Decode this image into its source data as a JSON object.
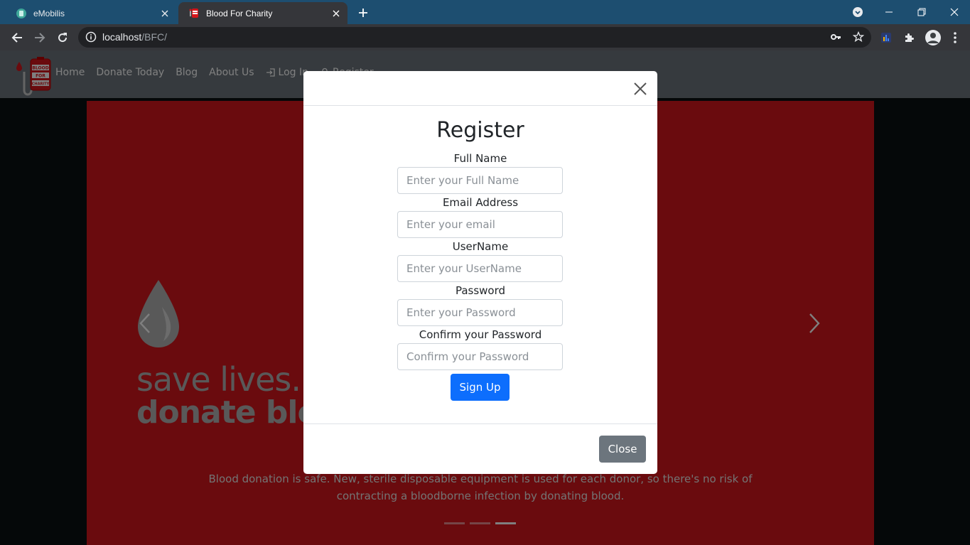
{
  "browser": {
    "tabs": [
      {
        "title": "eMobilis",
        "active": false
      },
      {
        "title": "Blood For Charity",
        "active": true
      }
    ],
    "url_host": "localhost",
    "url_path": "/BFC/"
  },
  "logo": {
    "line1": "BLOOD",
    "line2": "FOR",
    "line3": "CHARITY"
  },
  "nav": {
    "home": "Home",
    "donate": "Donate Today",
    "blog": "Blog",
    "about": "About Us",
    "login": "Log In",
    "register": "Register"
  },
  "hero": {
    "tagline_1": "save lives.",
    "tagline_2": "donate blood",
    "caption": "Blood donation is safe. New, sterile disposable equipment is used for each donor, so there's no risk of contracting a bloodborne infection by donating blood.",
    "slides_total": 3,
    "active_slide": 3
  },
  "modal": {
    "title": "Register",
    "fields": [
      {
        "label": "Full Name",
        "placeholder": "Enter your Full Name"
      },
      {
        "label": "Email Address",
        "placeholder": "Enter your email"
      },
      {
        "label": "UserName",
        "placeholder": "Enter your UserName"
      },
      {
        "label": "Password",
        "placeholder": "Enter your Password"
      },
      {
        "label": "Confirm your Password",
        "placeholder": "Confirm your Password"
      }
    ],
    "submit_label": "Sign Up",
    "close_label": "Close"
  },
  "colors": {
    "brand_red": "#d4161c",
    "navbar": "#6c757d",
    "primary": "#0d6efd",
    "secondary": "#6c757d"
  },
  "icons": [
    "favicon-emobilis-icon",
    "favicon-bfc-icon",
    "close-tab-icon",
    "new-tab-icon",
    "back-icon",
    "forward-icon",
    "reload-icon",
    "info-icon",
    "key-icon",
    "star-icon",
    "extensions-icon",
    "profile-avatar",
    "menu-icon",
    "login-icon",
    "user-icon",
    "blood-drop-icon",
    "chevron-left-icon",
    "chevron-right-icon",
    "close-icon"
  ]
}
